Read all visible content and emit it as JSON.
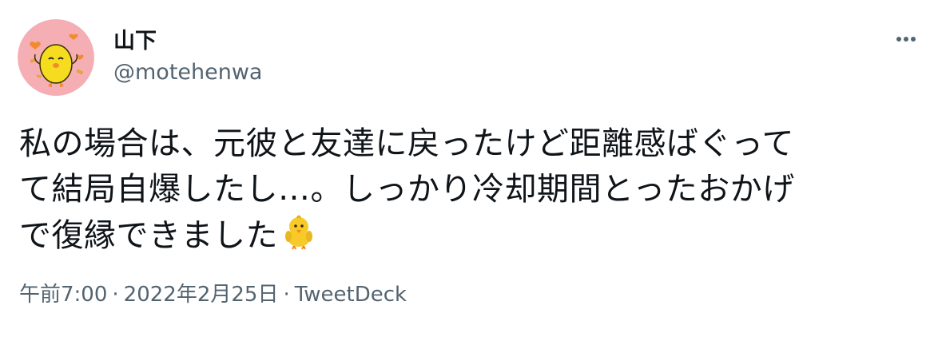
{
  "user": {
    "display_name": "山下",
    "handle": "@motehenwa",
    "avatar_icon": "chick-avatar-icon"
  },
  "tweet": {
    "lines": [
      "私の場合は、元彼と友達に戻ったけど距離感ばぐって",
      "て結局自爆したし…。しっかり冷却期間とったおかげ",
      "で復縁できました"
    ],
    "emoji": "chick-emoji-icon"
  },
  "meta": {
    "time": "午前7:00",
    "separator": "·",
    "date": "2022年2月25日",
    "source": "TweetDeck"
  },
  "menu": {
    "icon": "more-icon"
  },
  "colors": {
    "text": "#0f1419",
    "secondary": "#536471",
    "avatar_bg": "#f4aeb4",
    "chick": "#f5dc1e"
  }
}
